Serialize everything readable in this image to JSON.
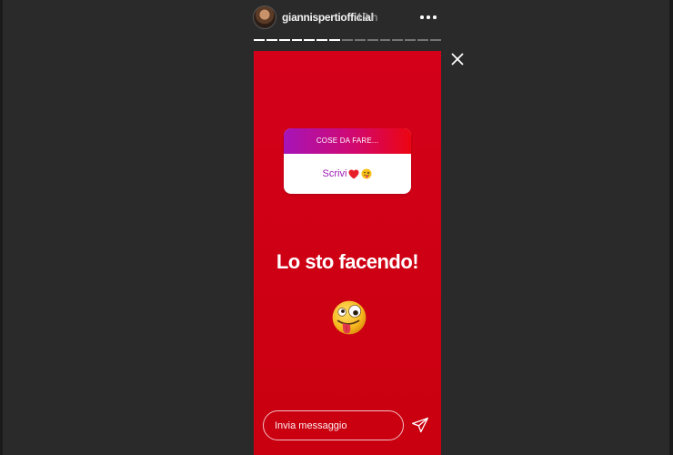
{
  "header": {
    "username": "giannispertiofficial",
    "time": "19 h",
    "more_icon": "more-horizontal-icon"
  },
  "progress": {
    "segments_total": 15,
    "segments_viewed": 7
  },
  "close_icon": "close-icon",
  "story": {
    "question_sticker": {
      "question": "COSE DA FARE...",
      "answer": "Scrivi",
      "answer_emojis": [
        "red-heart-icon",
        "tongue-out-emoji-icon"
      ]
    },
    "text": "Lo sto facendo!",
    "emoji": "zany-face-emoji-icon",
    "background_color": "#d4001a"
  },
  "reply": {
    "placeholder": "Invia messaggio",
    "send_icon": "send-icon"
  }
}
